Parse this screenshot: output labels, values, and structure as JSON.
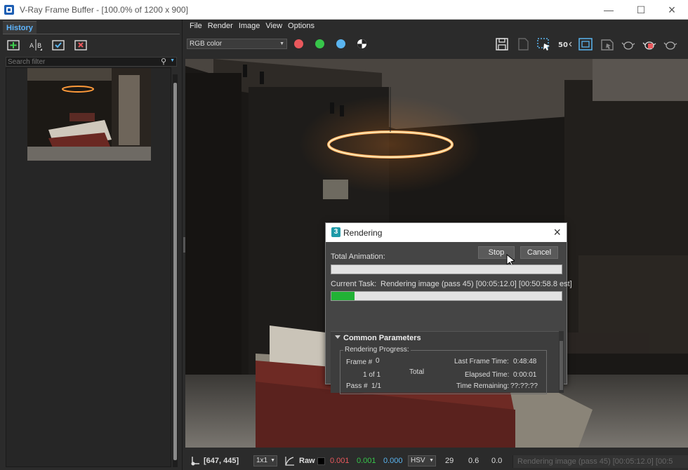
{
  "window": {
    "title": "V-Ray Frame Buffer - [100.0% of 1200 x 900]"
  },
  "history": {
    "tab_label": "History",
    "search_placeholder": "Search filter",
    "tools": [
      "save-to-history-icon",
      "ab-compare-icon",
      "load-image-icon",
      "remove-image-icon"
    ]
  },
  "menu": [
    "File",
    "Render",
    "Image",
    "View",
    "Options"
  ],
  "toolbar": {
    "channel": "RGB color",
    "colors": {
      "red": "#e9585c",
      "green": "#37c54a",
      "blue": "#5ab4ef"
    },
    "zoom_label": "50"
  },
  "status": {
    "coords": "[647, 445]",
    "sampling": "1x1",
    "raw_label": "Raw",
    "r": "0.001",
    "g": "0.001",
    "b": "0.000",
    "mode": "HSV",
    "h": "29",
    "s": "0.6",
    "v": "0.0",
    "message": "Rendering image (pass 45) [00:05:12.0] [00:5"
  },
  "dialog": {
    "title": "Rendering",
    "stop_label": "Stop",
    "cancel_label": "Cancel",
    "total_animation_label": "Total Animation:",
    "current_task_label": "Current Task:",
    "current_task_value": "Rendering image (pass 45) [00:05:12.0] [00:50:58.8 est]",
    "total_progress": 0.0,
    "task_progress": 0.1,
    "section_title": "Common Parameters",
    "group_label": "Rendering Progress:",
    "frame_label": "Frame #",
    "frame_value": "0",
    "of_label": "1 of 1",
    "total_label": "Total",
    "pass_label": "Pass #",
    "pass_value": "1/1",
    "last_frame_label": "Last Frame Time:",
    "last_frame_value": "0:48:48",
    "elapsed_label": "Elapsed Time:",
    "elapsed_value": "0:00:01",
    "remaining_label": "Time Remaining:",
    "remaining_value": "??:??:??"
  }
}
